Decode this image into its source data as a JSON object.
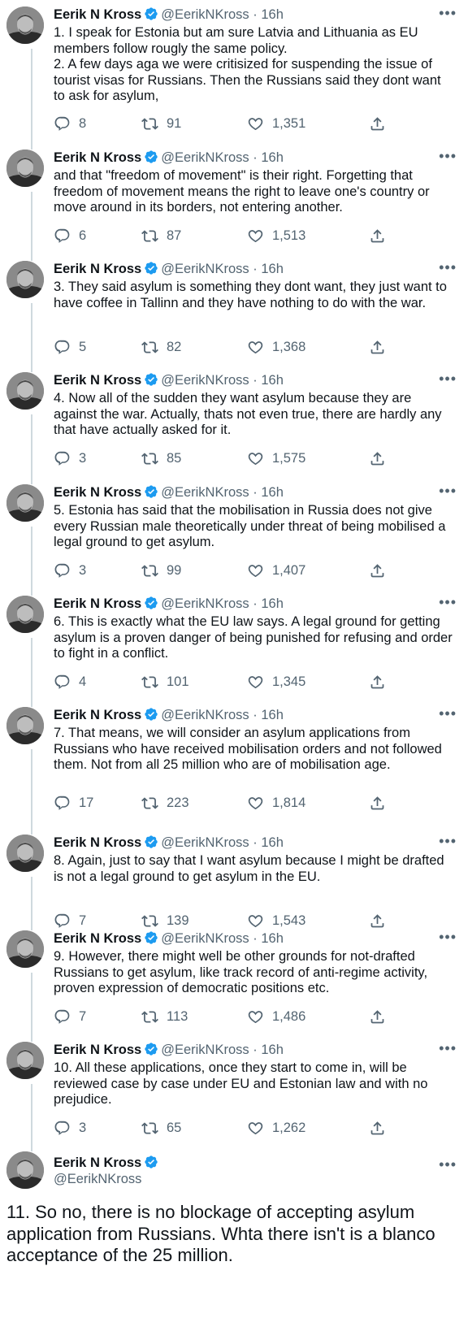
{
  "author": {
    "name": "Eerik N Kross",
    "handle": "@EerikNKross",
    "dot": "·",
    "time": "16h",
    "verified": true,
    "more_icon": "more-horizontal-icon"
  },
  "colors": {
    "text": "#0f1419",
    "secondary": "#536471",
    "verified": "#1d9bf0",
    "thread_line": "#cfd9de"
  },
  "tweets": [
    {
      "text": "1. I speak for Estonia but am sure Latvia and Lithuania as EU members follow rougly the same policy.\n2. A few days aga we were critisized for suspending the issue of tourist visas for Russians. Then the Russians said they dont want to ask for asylum,",
      "replies": "8",
      "retweets": "91",
      "likes": "1,351"
    },
    {
      "text": "and that \"freedom of movement\" is their right. Forgetting that freedom of movement means the right to leave one's country or move around in its borders, not entering another.",
      "replies": "6",
      "retweets": "87",
      "likes": "1,513"
    },
    {
      "text": "3. They said asylum is something they dont want, they just want to have coffee in Tallinn and they have nothing to do with the war.",
      "replies": "5",
      "retweets": "82",
      "likes": "1,368"
    },
    {
      "text": "4. Now all of the sudden they want asylum because they are against the war. Actually, thats not even true, there are hardly any that have actually asked for it.",
      "replies": "3",
      "retweets": "85",
      "likes": "1,575"
    },
    {
      "text": "5. Estonia has said that the mobilisation in Russia does not give every Russian male theoretically under threat of being mobilised a legal ground to get asylum.",
      "replies": "3",
      "retweets": "99",
      "likes": "1,407"
    },
    {
      "text": "6. This is exactly what the EU law says. A legal ground for getting asylum is a proven danger of being punished for refusing and order to fight in a conflict.",
      "replies": "4",
      "retweets": "101",
      "likes": "1,345"
    },
    {
      "text": "7. That means, we will consider an asylum applications from Russians who have received mobilisation orders and not followed them. Not from all 25 million who are of mobilisation age.",
      "replies": "17",
      "retweets": "223",
      "likes": "1,814"
    },
    {
      "text": "8. Again, just to say that I want asylum because I might be drafted is not a legal ground to get asylum in the EU.",
      "replies": "7",
      "retweets": "139",
      "likes": "1,543"
    },
    {
      "text": "9. However, there might well be other grounds for not-drafted Russians to get asylum, like track record of anti-regime activity, proven expression of democratic positions etc.",
      "replies": "7",
      "retweets": "113",
      "likes": "1,486"
    },
    {
      "text": "10. All these applications, once they start to come in, will be reviewed case by case under EU and Estonian law and with no prejudice.",
      "replies": "3",
      "retweets": "65",
      "likes": "1,262"
    }
  ],
  "final_tweet": {
    "text": "11. So no, there is no blockage of accepting asylum application from Russians. Whta there isn't is a blanco acceptance of the 25 million."
  }
}
